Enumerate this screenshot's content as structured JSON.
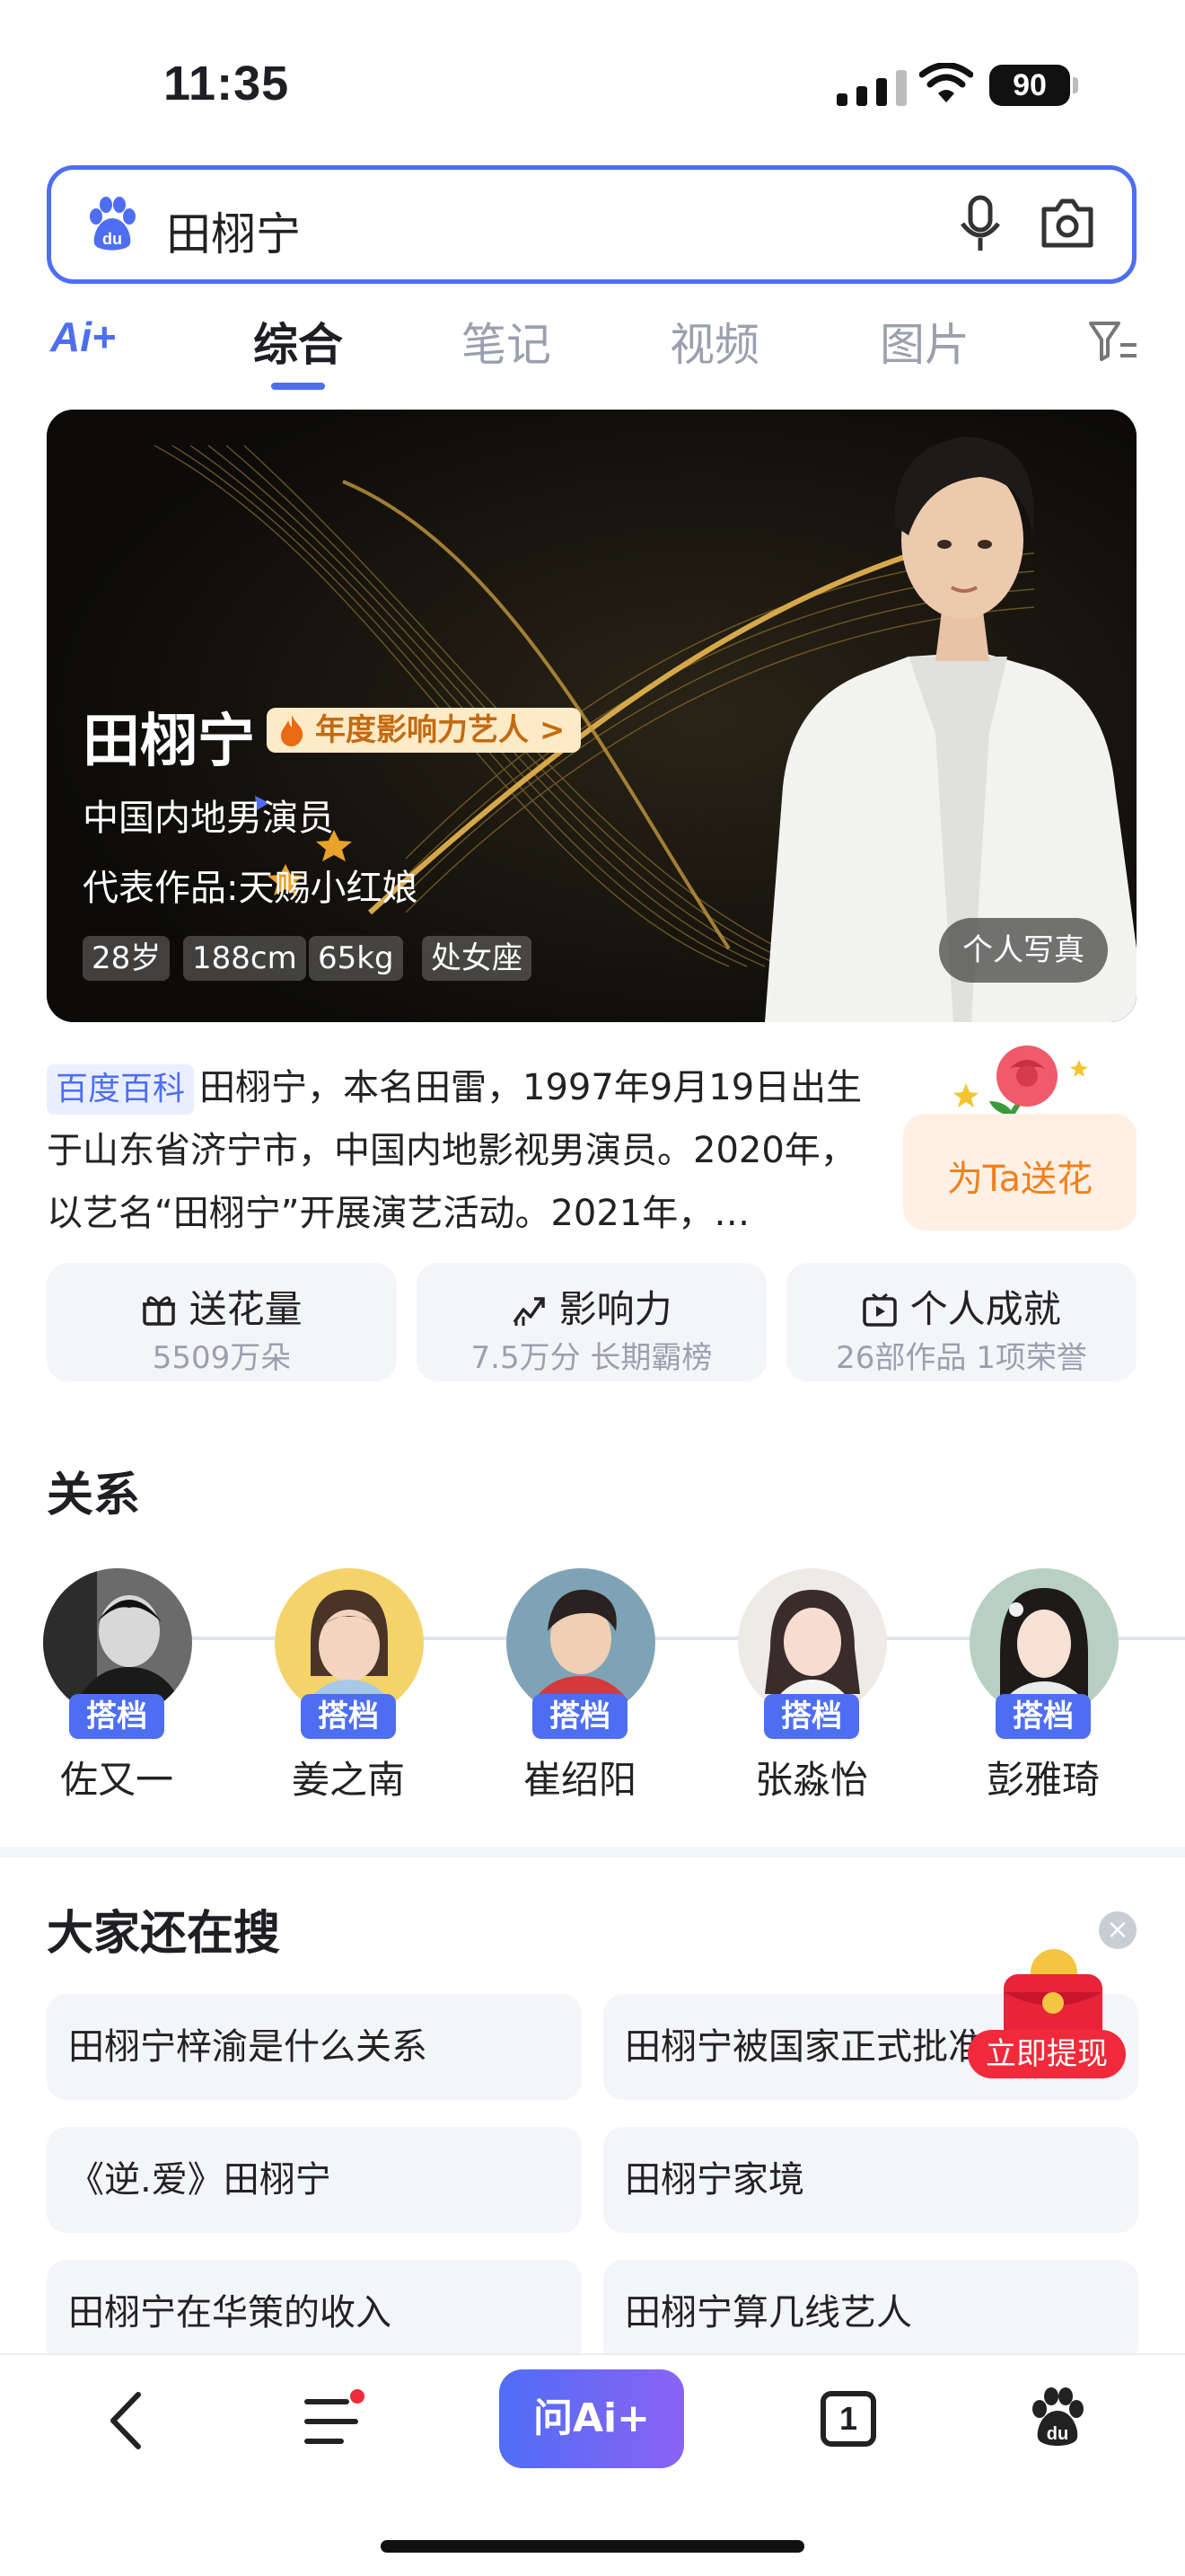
{
  "status_bar": {
    "time": "11:35",
    "battery": "90"
  },
  "search": {
    "query": "田栩宁"
  },
  "tabs": {
    "ai_label": "Ai+",
    "items": [
      "综合",
      "笔记",
      "视频",
      "图片"
    ]
  },
  "hero": {
    "name": "田栩宁",
    "badge": "年度影响力艺人 >",
    "job": "中国内地男演员",
    "works": "代表作品:天赐小红娘",
    "tags": [
      "28岁",
      "188cm",
      "65kg",
      "处女座"
    ],
    "photo_button": "个人写真"
  },
  "baike": {
    "tag": "百度百科",
    "text": "田栩宁，本名田雷，1997年9月19日出生于山东省济宁市，中国内地影视男演员。2020年，以艺名“田栩宁”开展演艺活动。2021年，…",
    "flower_button": "为Ta送花"
  },
  "stats": [
    {
      "title": "送花量",
      "sub": "5509万朵"
    },
    {
      "title": "影响力",
      "sub": "7.5万分  长期霸榜"
    },
    {
      "title": "个人成就",
      "sub": "26部作品  1项荣誉"
    }
  ],
  "relations": {
    "title": "关系",
    "items": [
      {
        "tag": "搭档",
        "name": "佐又一"
      },
      {
        "tag": "搭档",
        "name": "姜之南"
      },
      {
        "tag": "搭档",
        "name": "崔绍阳"
      },
      {
        "tag": "搭档",
        "name": "张淼怡"
      },
      {
        "tag": "搭档",
        "name": "彭雅琦"
      }
    ]
  },
  "also_search": {
    "title": "大家还在搜",
    "items": [
      "田栩宁梓渝是什么关系",
      "田栩宁被国家正式批准",
      "《逆.爱》田栩宁",
      "田栩宁家境",
      "田栩宁在华策的收入",
      "田栩宁算几线艺人"
    ],
    "promo_button": "立即提现"
  },
  "bottom_bar": {
    "ask_ai": "问Ai+",
    "tab_count": "1"
  },
  "colors": {
    "accent": "#4e6ef2",
    "promo": "#f02a3a",
    "flower": "#f0801c"
  }
}
